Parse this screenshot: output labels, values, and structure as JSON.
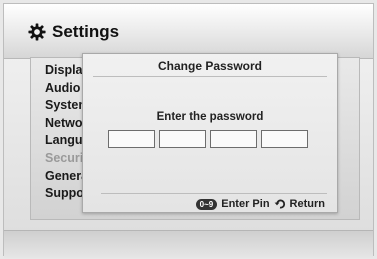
{
  "header": {
    "title": "Settings",
    "icon": "gear-icon"
  },
  "menu": {
    "items": [
      {
        "label": "Display",
        "active": true
      },
      {
        "label": "Audio",
        "active": true
      },
      {
        "label": "System",
        "active": true
      },
      {
        "label": "Network",
        "active": true
      },
      {
        "label": "Language",
        "active": true
      },
      {
        "label": "Security",
        "active": false
      },
      {
        "label": "General",
        "active": true
      },
      {
        "label": "Support",
        "active": true
      }
    ]
  },
  "dialog": {
    "title": "Change Password",
    "prompt": "Enter the password",
    "pin_count": 4,
    "footer": {
      "pin_key_label": "0~9",
      "pin_label": "Enter Pin",
      "return_icon": "return-icon",
      "return_label": "Return"
    }
  }
}
